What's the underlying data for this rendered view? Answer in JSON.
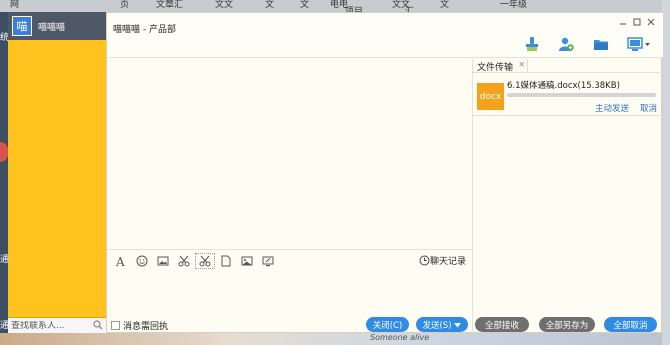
{
  "desktop": {
    "top_segments": [
      "网",
      "页",
      "文章汇",
      "文文",
      "文",
      "文",
      "电电",
      "项目",
      "文文",
      "汇",
      "文",
      "一年级"
    ],
    "left_chars": [
      "统",
      "通",
      "通"
    ],
    "bottom_text": "Someone alive"
  },
  "contacts": {
    "avatar_char": "喵",
    "user_name": "喵喵喵",
    "search_placeholder": "查找联系人..."
  },
  "chat": {
    "title": "喵喵喵 - 产品部",
    "history_label": "聊天记录",
    "receipt_label": "消息需回执",
    "close_label": "关闭(C)",
    "send_label": "发送(S)"
  },
  "file_panel": {
    "tab_label": "文件传输",
    "files": [
      {
        "icon_label": "docx",
        "name": "6.1媒体通稿.docx(15.38KB)",
        "progress": 0,
        "action_send": "主动发送",
        "action_cancel": "取消"
      }
    ],
    "receive_all": "全部接收",
    "save_all": "全部另存为",
    "cancel_all": "全部取消"
  },
  "colors": {
    "accent": "#ffc21e",
    "button_blue": "#2f8be6",
    "button_gray": "#6f6f6f",
    "file_icon": "#f2a21b"
  }
}
